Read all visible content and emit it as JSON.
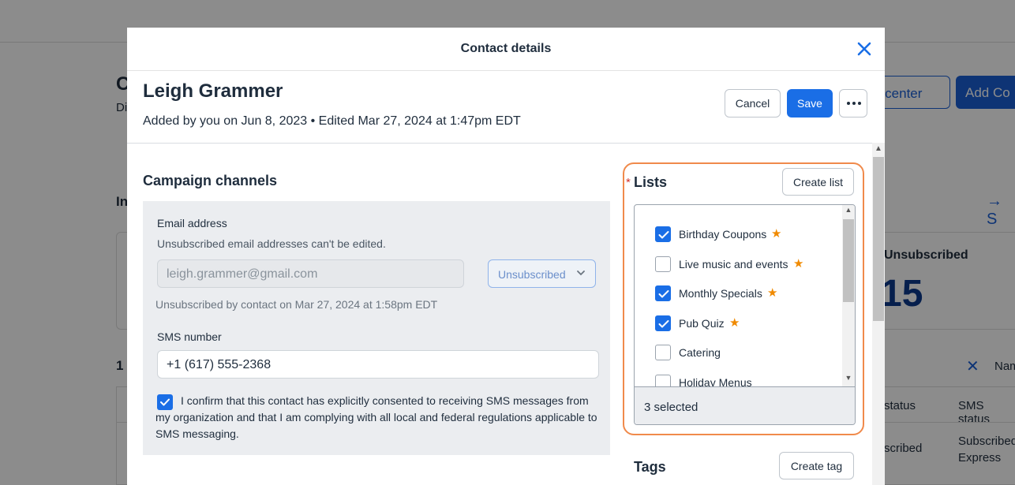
{
  "background": {
    "title": "C",
    "subtitle": "Di",
    "btn_outline": "h center",
    "btn_solid": "Add Co",
    "section": "In",
    "arrow": "→ S",
    "unsub_label": "Unsubscribed",
    "unsub_count": "15",
    "count": "1 (",
    "filter_name": "Nam",
    "col_email_status": "status",
    "col_sms_status": "SMS status",
    "cell_email_status": "scribed",
    "cell_sms_status": "Subscribed Express"
  },
  "modal": {
    "title": "Contact details",
    "contact": {
      "name": "Leigh Grammer",
      "meta": "Added by you on Jun 8, 2023 • Edited Mar 27, 2024 at 1:47pm EDT"
    },
    "actions": {
      "cancel": "Cancel",
      "save": "Save"
    },
    "campaign_channels": {
      "title": "Campaign channels",
      "email_label": "Email address",
      "email_hint": "Unsubscribed email addresses can't be edited.",
      "email_value": "leigh.grammer@gmail.com",
      "email_status": "Unsubscribed",
      "unsub_note": "Unsubscribed by contact on Mar 27, 2024 at 1:58pm EDT",
      "sms_label": "SMS number",
      "sms_value": "+1 (617) 555-2368",
      "consent_checked": true,
      "consent_text": "I confirm that this contact has explicitly consented to receiving SMS messages from my organization and that I am complying with all local and federal regulations applicable to SMS messaging."
    },
    "lists": {
      "required_marker": "*",
      "title": "Lists",
      "create_label": "Create list",
      "items": [
        {
          "label": "Birthday Coupons",
          "checked": true,
          "starred": true
        },
        {
          "label": "Live music and events",
          "checked": false,
          "starred": true
        },
        {
          "label": "Monthly Specials",
          "checked": true,
          "starred": true
        },
        {
          "label": "Pub Quiz",
          "checked": true,
          "starred": true
        },
        {
          "label": "Catering",
          "checked": false,
          "starred": false
        },
        {
          "label": "Holiday Menus",
          "checked": false,
          "starred": false
        }
      ],
      "selected_summary": "3 selected"
    },
    "tags": {
      "title": "Tags",
      "create_label": "Create tag"
    }
  },
  "colors": {
    "primary": "#1a6ee6",
    "highlight": "#f08a4b",
    "star": "#f08a00"
  }
}
